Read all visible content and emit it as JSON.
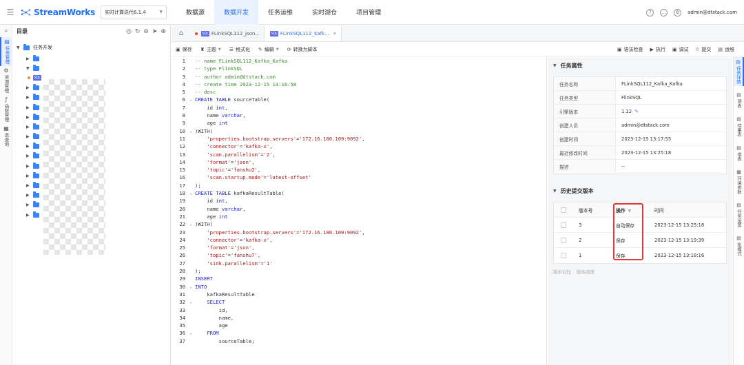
{
  "header": {
    "brand": "StreamWorks",
    "version_select": "实时计算迭代6.1.4",
    "nav": [
      "数据源",
      "数据开发",
      "任务运维",
      "实时湖仓",
      "项目管理"
    ],
    "active_nav": "数据开发",
    "user_email": "admin@dtstack.com"
  },
  "left_rail": [
    {
      "label": "任务管理",
      "icon": "task-icon",
      "active": true
    },
    {
      "label": "资源管理",
      "icon": "resource-icon",
      "active": false
    },
    {
      "label": "函数管理",
      "icon": "function-icon",
      "active": false
    },
    {
      "label": "表查询",
      "icon": "table-icon",
      "active": false
    }
  ],
  "catalog": {
    "title": "目录",
    "root": "任务开发"
  },
  "tabs": [
    {
      "label": "FLinkSQL112_json...",
      "modified": true,
      "active": false
    },
    {
      "label": "FLinkSQL112_Kafk...",
      "modified": false,
      "active": true
    }
  ],
  "toolbar": {
    "left": [
      "保存",
      "主题",
      "格式化",
      "编辑",
      "转换为脚本"
    ],
    "right": [
      "语法检查",
      "执行",
      "调试",
      "提交",
      "运维"
    ]
  },
  "code": [
    "-- name FLinkSQL112_Kafka_Kafka",
    "-- type FlinkSQL",
    "-- author admin@dtstack.com",
    "-- create time 2023-12-15 13:16:58",
    "-- desc",
    "CREATE TABLE sourceTable(",
    "    id int,",
    "    name varchar,",
    "    age int",
    ")WITH(",
    "    'properties.bootstrap.servers'='172.16.100.109:9092',",
    "    'connector'='kafka-x',",
    "    'scan.parallelism'='2',",
    "    'format'='json',",
    "    'topic'='fanshu2',",
    "    'scan.startup.mode'='latest-offset'",
    ");",
    "CREATE TABLE kafkaResultTable(",
    "    id int,",
    "    name varchar,",
    "    age int",
    ")WITH(",
    "    'properties.bootstrap.servers'='172.16.100.109:9092',",
    "    'connector'='kafka-x',",
    "    'format'='json',",
    "    'topic'='fanshu7',",
    "    'sink.parallelism'='1'",
    ");",
    "INSERT",
    "INTO",
    "    kafkaResultTable",
    "    SELECT",
    "        id,",
    "        name,",
    "        age",
    "    FROM",
    "        sourceTable;"
  ],
  "properties": {
    "title": "任务属性",
    "rows": [
      {
        "key": "任务名称",
        "value": "FLinkSQL112_Kafka_Kafka"
      },
      {
        "key": "任务类型",
        "value": "FlinkSQL"
      },
      {
        "key": "引擎版本",
        "value": "1.12"
      },
      {
        "key": "创建人员",
        "value": "admin@dtstack.com"
      },
      {
        "key": "创建时间",
        "value": "2023-12-15 13:17:55"
      },
      {
        "key": "最近修改时间",
        "value": "2023-12-15 13:25:18"
      },
      {
        "key": "描述",
        "value": "--"
      }
    ]
  },
  "history": {
    "title": "历史提交版本",
    "columns": [
      "版本号",
      "操作",
      "时间"
    ],
    "rows": [
      {
        "version": "3",
        "op": "自动保存",
        "time": "2023-12-15 13:25:18"
      },
      {
        "version": "2",
        "op": "保存",
        "time": "2023-12-15 13:19:39"
      },
      {
        "version": "1",
        "op": "保存",
        "time": "2023-12-15 13:18:16"
      }
    ],
    "actions": [
      "版本对比",
      "版本回滚"
    ]
  },
  "right_rail": [
    {
      "label": "任务详情",
      "icon": "detail-icon",
      "active": true
    },
    {
      "label": "源表",
      "icon": "source-icon",
      "active": false
    },
    {
      "label": "结果表",
      "icon": "result-icon",
      "active": false
    },
    {
      "label": "维表",
      "icon": "dim-icon",
      "active": false
    },
    {
      "label": "环境参数",
      "icon": "env-icon",
      "active": false
    },
    {
      "label": "任务设置",
      "icon": "settings-icon",
      "active": false
    },
    {
      "label": "批模式",
      "icon": "batch-icon",
      "active": false
    }
  ]
}
